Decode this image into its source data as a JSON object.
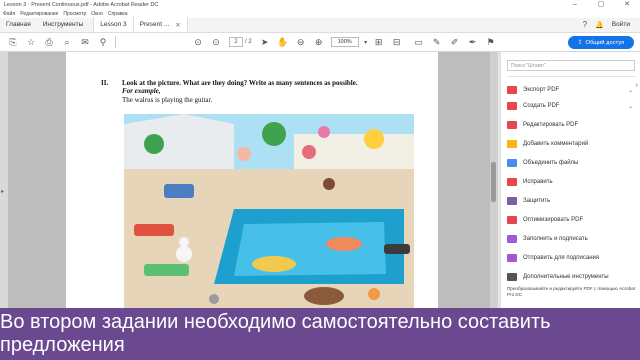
{
  "window": {
    "title": "Lesson 3 · Present Continuous.pdf - Adobe Acrobat Reader DC"
  },
  "menu": [
    "Файл",
    "Редактирование",
    "Просмотр",
    "Окно",
    "Справка"
  ],
  "tabs": {
    "home": "Главная",
    "tools": "Инструменты",
    "doc1": "Lesson 3",
    "doc2": "Present ..."
  },
  "header": {
    "signin": "Войти"
  },
  "toolbar": {
    "page_current": "2",
    "page_total": "/ 2",
    "zoom": "100%"
  },
  "share_button": "Общий доступ",
  "document": {
    "task_number": "II.",
    "task_text": "Look at the picture. What are they doing? Write as many sentences as possible.",
    "example_label": "For example,",
    "example_text": "The walrus is playing the guitar."
  },
  "right_panel": {
    "search_placeholder": "Поиск \"Штамп\"",
    "tools": [
      {
        "label": "Экспорт PDF",
        "icon": "export-pdf-icon",
        "color": "#e34850",
        "chevron": true
      },
      {
        "label": "Создать PDF",
        "icon": "create-pdf-icon",
        "color": "#e34850",
        "chevron": true
      },
      {
        "label": "Редактировать PDF",
        "icon": "edit-pdf-icon",
        "color": "#e34850",
        "chevron": false
      },
      {
        "label": "Добавить комментарий",
        "icon": "comment-icon",
        "color": "#f6b21b",
        "chevron": false
      },
      {
        "label": "Объединить файлы",
        "icon": "combine-files-icon",
        "color": "#4a8fe7",
        "chevron": false
      },
      {
        "label": "Исправить",
        "icon": "organize-icon",
        "color": "#e34850",
        "chevron": false
      },
      {
        "label": "Защитить",
        "icon": "protect-icon",
        "color": "#7b5ea7",
        "chevron": false
      },
      {
        "label": "Оптимизировать PDF",
        "icon": "optimize-icon",
        "color": "#e34850",
        "chevron": false
      },
      {
        "label": "Заполнить и подписать",
        "icon": "fill-sign-icon",
        "color": "#a05ad3",
        "chevron": false
      },
      {
        "label": "Отправить для подписания",
        "icon": "send-sign-icon",
        "color": "#a05ad3",
        "chevron": false
      },
      {
        "label": "Дополнительные инструменты",
        "icon": "more-tools-icon",
        "color": "#555555",
        "chevron": false
      }
    ],
    "footer": "Преобразовывайте и редактируйте PDF с помощью Acrobat Pro DC"
  },
  "subtitle": "Во втором задании необходимо самостоятельно составить предложения"
}
